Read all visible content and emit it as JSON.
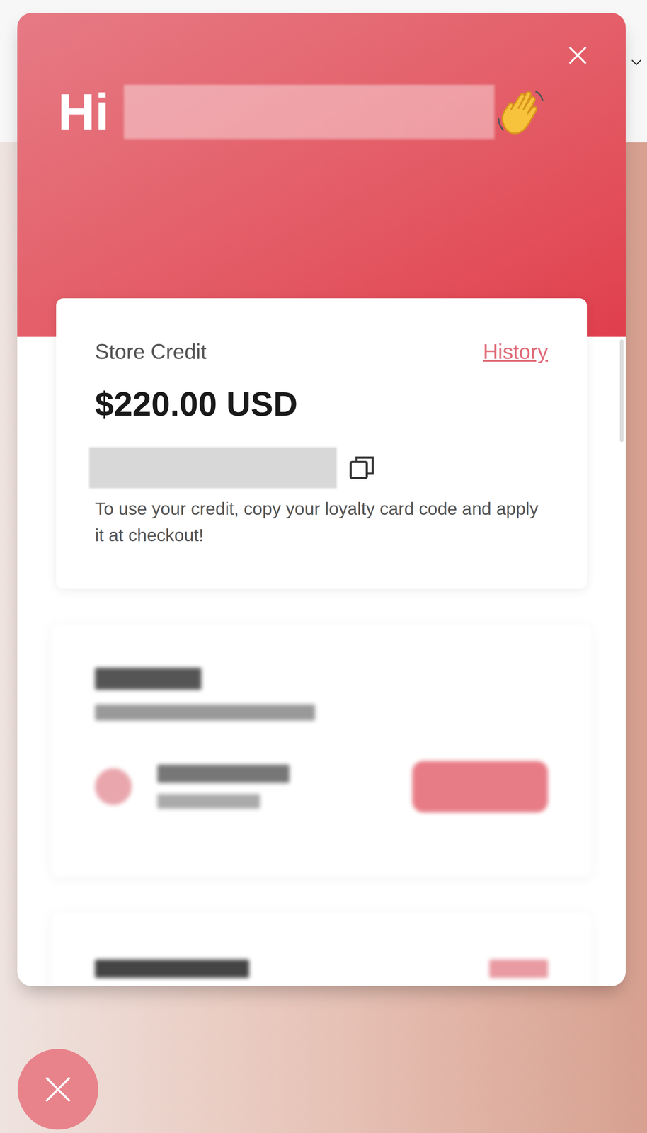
{
  "header": {
    "greeting": "Hi"
  },
  "store_credit": {
    "label": "Store Credit",
    "history_link": "History",
    "amount": "$220.00 USD",
    "instructions": "To use your credit, copy your loyalty card code and apply it at checkout!"
  }
}
